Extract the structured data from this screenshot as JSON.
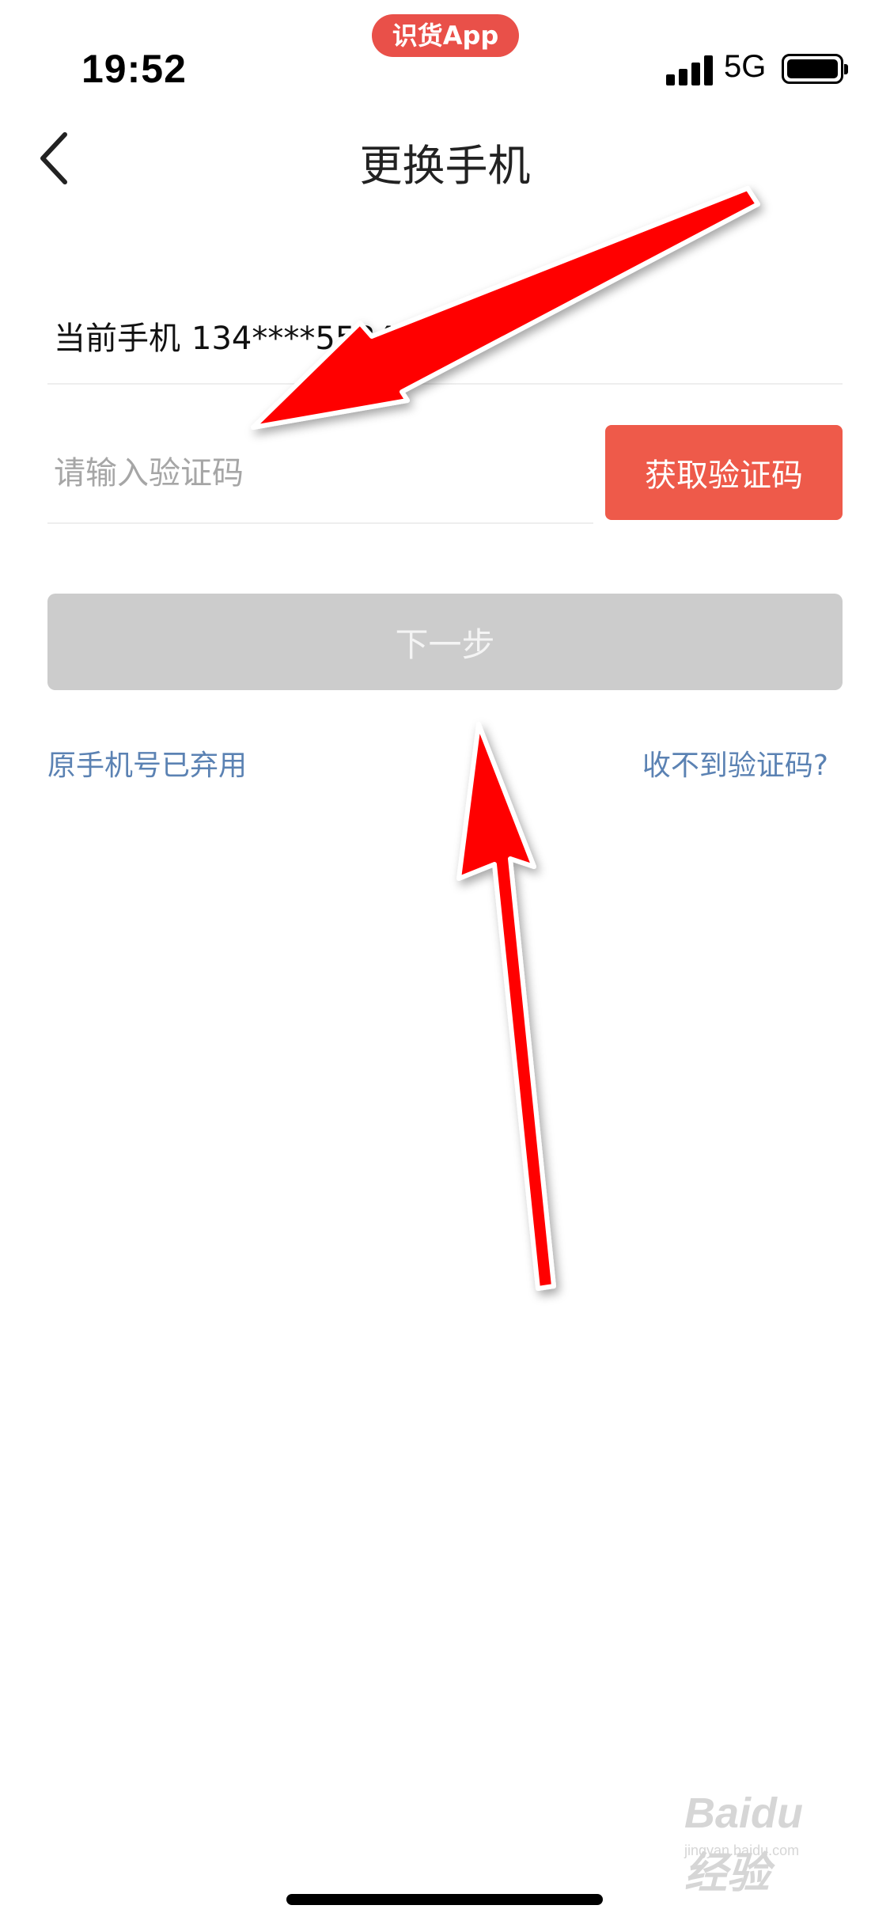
{
  "status_bar": {
    "time": "19:52",
    "app_pill": "识货App",
    "network": "5G"
  },
  "nav": {
    "title": "更换手机"
  },
  "form": {
    "current_label": "当前手机",
    "current_number": "134****5534",
    "code_placeholder": "请输入验证码",
    "code_value": "",
    "get_code_label": "获取验证码",
    "next_label": "下一步"
  },
  "links": {
    "abandoned": "原手机号已弃用",
    "no_code": "收不到验证码?"
  },
  "watermark": {
    "main": "Baidu 经验",
    "sub": "jingyan.baidu.com"
  },
  "colors": {
    "accent": "#ee5a4a",
    "app_pill": "#e95049",
    "link": "#5b82b3",
    "disabled_button": "#cccccc",
    "annotation_arrow": "#ff0000"
  }
}
